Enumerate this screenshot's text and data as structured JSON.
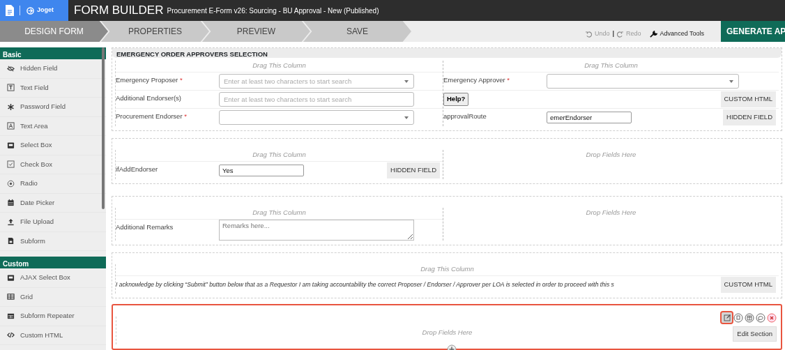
{
  "app": {
    "brand": "Joget",
    "title": "FORM BUILDER",
    "subtitle": "Procurement E-Form v26: Sourcing - BU Approval - New (Published)"
  },
  "steps": [
    {
      "label": "DESIGN FORM",
      "selected": true
    },
    {
      "label": "PROPERTIES",
      "selected": false
    },
    {
      "label": "PREVIEW",
      "selected": false
    },
    {
      "label": "SAVE",
      "selected": false
    }
  ],
  "toolbar": {
    "undo": "Undo",
    "separator": "|",
    "redo": "Redo",
    "advanced": "Advanced Tools",
    "generate": "GENERATE AP"
  },
  "palette": [
    {
      "title": "Basic",
      "items": [
        {
          "kind": "hidden",
          "label": "Hidden Field"
        },
        {
          "kind": "text",
          "label": "Text Field"
        },
        {
          "kind": "password",
          "label": "Password Field"
        },
        {
          "kind": "textarea",
          "label": "Text Area"
        },
        {
          "kind": "select",
          "label": "Select Box"
        },
        {
          "kind": "checkbox",
          "label": "Check Box"
        },
        {
          "kind": "radio",
          "label": "Radio"
        },
        {
          "kind": "date",
          "label": "Date Picker"
        },
        {
          "kind": "upload",
          "label": "File Upload"
        },
        {
          "kind": "subform",
          "label": "Subform"
        }
      ]
    },
    {
      "title": "Custom",
      "items": [
        {
          "kind": "select",
          "label": "AJAX Select Box"
        },
        {
          "kind": "grid",
          "label": "Grid"
        },
        {
          "kind": "repeater",
          "label": "Subform Repeater"
        },
        {
          "kind": "html",
          "label": "Custom HTML"
        }
      ]
    }
  ],
  "sections": [
    {
      "title": "EMERGENCY ORDER APPROVERS SELECTION",
      "selected": false,
      "columns": [
        {
          "header": "Drag This Column",
          "fields": [
            {
              "kind": "select",
              "label": "Emergency Proposer",
              "marker": "*",
              "placeholder": "Enter at least two characters to start search"
            },
            {
              "kind": "text",
              "label": "Additional Endorser(s)",
              "placeholder": "Enter at least two characters to start search"
            },
            {
              "kind": "select",
              "label": "Procurement Endorser",
              "marker": "*"
            }
          ]
        },
        {
          "header": "Drag This Column",
          "fields": [
            {
              "kind": "select",
              "label": "Emergency Approver",
              "marker": "*"
            },
            {
              "kind": "button",
              "label": "Help?",
              "tag": "CUSTOM HTML"
            },
            {
              "kind": "hidden",
              "label": "approvalRoute",
              "value": "emerEndorser",
              "tag": "HIDDEN FIELD"
            }
          ]
        }
      ]
    },
    {
      "selected": false,
      "columns": [
        {
          "header": "Drag This Column",
          "fields": [
            {
              "kind": "hidden",
              "label": "ifAddEndorser",
              "value": "Yes",
              "tag": "HIDDEN FIELD"
            }
          ]
        },
        {
          "header": "Drop Fields Here"
        }
      ]
    },
    {
      "selected": false,
      "columns": [
        {
          "header": "Drag This Column",
          "fields": [
            {
              "kind": "textarea",
              "label": "Additional Remarks",
              "placeholder": "Remarks here..."
            }
          ]
        },
        {
          "header": "Drop Fields Here"
        }
      ]
    },
    {
      "selected": false,
      "columns": [
        {
          "header": "Drag This Column",
          "fields": [
            {
              "kind": "statement",
              "label": "I acknowledge by clicking “Submit” button below that as a Requestor I am taking accountability the correct Proposer / Endorser / Approver per LOA is selected in order to proceed with this s",
              "tag": "CUSTOM HTML"
            }
          ]
        }
      ]
    },
    {
      "selected": true,
      "columns": [
        {
          "header": "Drop Fields Here"
        }
      ],
      "tools": [
        {
          "kind": "edit",
          "highlighted": true
        },
        {
          "kind": "copy",
          "highlighted": false
        },
        {
          "kind": "columns",
          "highlighted": false
        },
        {
          "kind": "comment",
          "highlighted": false
        },
        {
          "kind": "delete",
          "highlighted": false
        }
      ],
      "tooltip": "Edit Section"
    }
  ]
}
